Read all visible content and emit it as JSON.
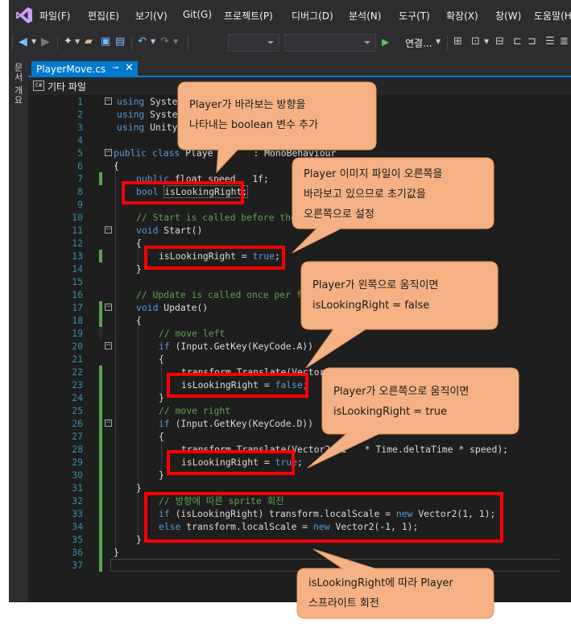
{
  "menu": [
    "파일(F)",
    "편집(E)",
    "보기(V)",
    "Git(G)",
    "프로젝트(P)",
    "디버그(D)",
    "분석(N)",
    "도구(T)",
    "확장(X)",
    "창(W)",
    "도움말(H)"
  ],
  "toolbar": {
    "run_label": "연결..."
  },
  "side_panel": {
    "label": "문서 개요"
  },
  "tab": {
    "file_name": "PlayerMove.cs",
    "pin_glyph": "⊸",
    "close_glyph": "✕"
  },
  "navbar": {
    "badge": "C#",
    "label": "기타 파일"
  },
  "code": {
    "line_numbers": [
      "1",
      "2",
      "3",
      "4",
      "5",
      "6",
      "7",
      "8",
      "9",
      "10",
      "11",
      "12",
      "13",
      "14",
      "15",
      "16",
      "17",
      "18",
      "19",
      "20",
      "21",
      "22",
      "23",
      "24",
      "25",
      "26",
      "27",
      "28",
      "29",
      "30",
      "31",
      "32",
      "33",
      "34",
      "35",
      "36",
      "37"
    ],
    "l1_kw": "using",
    "l1_rest": " System.",
    "l2_kw": "using",
    "l2_rest": " System.",
    "l3_kw": "using",
    "l3_rest": " UnityEn",
    "l5_kw": "public class",
    "l5_a": " Playe",
    "l5_b": ": MonoBehaviour",
    "l6": "{",
    "l7_kw": "public",
    "l7_a": " float speed ",
    "l7_b": "1f;",
    "l8_kw": "bool",
    "l8_var": "isLookingRight;",
    "l10": "// Start is called before the",
    "l11_kw": "void",
    "l11_rest": " Start()",
    "l12": "{",
    "l13_a": "isLookingRight = ",
    "l13_kw": "true",
    "l13_b": ";",
    "l14": "}",
    "l16": "// Update is called once per fr",
    "l17_kw": "void",
    "l17_rest": " Update()",
    "l18": "{",
    "l19": "// move left",
    "l20_kw": "if",
    "l20_rest": " (Input.GetKey(KeyCode.A))",
    "l21": "{",
    "l22_a": "transform.Translate(Vector2",
    "l23_a": "isLookingRight = ",
    "l23_kw": "false",
    "l23_b": ";",
    "l24": "}",
    "l25": "// move right",
    "l26_kw": "if",
    "l26_rest": " (Input.GetKey(KeyCode.D))",
    "l27": "{",
    "l28_a": "transform.Translate(Vector2.ri",
    "l28_b": "* Time.deltaTime * speed);",
    "l29_a": "isLookingRight = ",
    "l29_kw": "true",
    "l29_b": ";",
    "l30": "}",
    "l31": "}",
    "l32": "// 방향에 따른 sprite 회전",
    "l33_kw": "if",
    "l33_a": " (isLookingRight) transform.localScale = ",
    "l33_kw2": "new",
    "l33_b": " Vector2(1, 1);",
    "l34_kw": "else",
    "l34_a": " transform.localScale = ",
    "l34_kw2": "new",
    "l34_b": " Vector2(-1, 1);",
    "l35": "}",
    "l36": "}"
  },
  "callouts": [
    {
      "id": "c1",
      "line1": "Player가 바라보는 방향을",
      "line2": "나타내는 boolean 변수 추가"
    },
    {
      "id": "c2",
      "line1": "Player 이미지 파일이 오른쪽을",
      "line2": "바라보고 있으므로 초기값을",
      "line3": "오른쪽으로 설정"
    },
    {
      "id": "c3",
      "line1": "Player가 왼쪽으로 움직이면",
      "line2": "isLookingRight = false"
    },
    {
      "id": "c4",
      "line1": "Player가 오른쪽으로 움직이면",
      "line2": "isLookingRight = true"
    },
    {
      "id": "c5",
      "line1": "isLookingRight에 따라 Player",
      "line2": "스프라이트 회전"
    }
  ],
  "colors": {
    "highlight": "#ff0000",
    "callout_fill": "#f4b183",
    "accent": "#007acc"
  }
}
